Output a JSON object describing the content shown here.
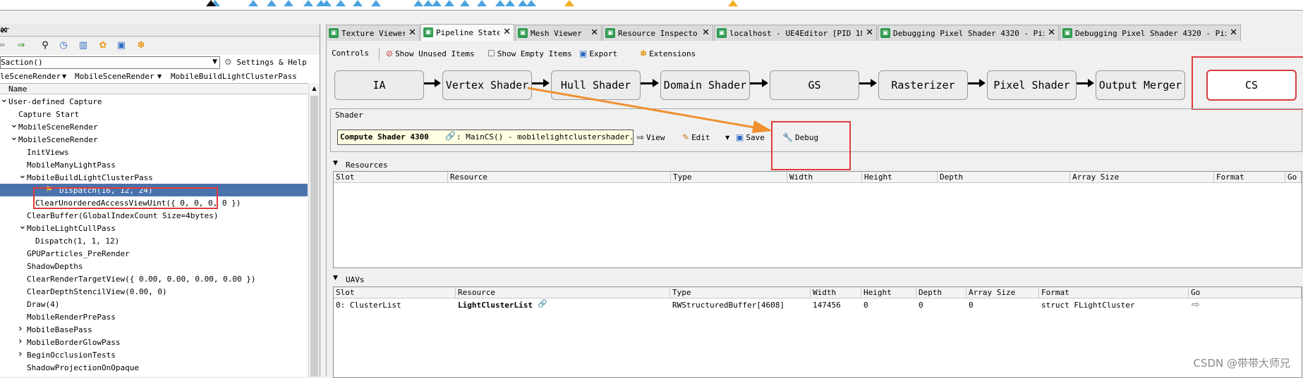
{
  "left_panel": {
    "title": "er",
    "section": "Saction()",
    "settings_help": "Settings & Help",
    "breadcrumb": [
      "leSceneRender",
      "MobileSceneRender",
      "MobileBuildLightClusterPass"
    ],
    "column_header": "Name",
    "tree": [
      {
        "label": "User-defined Capture",
        "indent": 0,
        "expander": "open"
      },
      {
        "label": "Capture Start",
        "indent": 1,
        "expander": "none"
      },
      {
        "label": "MobileSceneRender",
        "indent": 1,
        "expander": "open"
      },
      {
        "label": "MobileSceneRender",
        "indent": 2,
        "expander": "open"
      },
      {
        "label": "InitViews",
        "indent": 3,
        "expander": "none"
      },
      {
        "label": "MobileManyLightPass",
        "indent": 3,
        "expander": "none"
      },
      {
        "label": "MobileBuildLightClusterPass",
        "indent": 3,
        "expander": "open"
      },
      {
        "label": "Dispatch(16, 12, 24)",
        "indent": 4,
        "expander": "flag",
        "selected": true
      },
      {
        "label": "ClearUnorderedAccessViewUint({ 0, 0, 0, 0 })",
        "indent": 4,
        "expander": "none"
      },
      {
        "label": "ClearBuffer(GlobalIndexCount Size=4bytes)",
        "indent": 3,
        "expander": "none"
      },
      {
        "label": "MobileLightCullPass",
        "indent": 3,
        "expander": "open"
      },
      {
        "label": "Dispatch(1, 1, 12)",
        "indent": 4,
        "expander": "none"
      },
      {
        "label": "GPUParticles_PreRender",
        "indent": 3,
        "expander": "none"
      },
      {
        "label": "ShadowDepths",
        "indent": 3,
        "expander": "none"
      },
      {
        "label": "ClearRenderTargetView({ 0.00, 0.00, 0.00, 0.00 })",
        "indent": 3,
        "expander": "none"
      },
      {
        "label": "ClearDepthStencilView(0.00, 0)",
        "indent": 3,
        "expander": "none"
      },
      {
        "label": "Draw(4)",
        "indent": 3,
        "expander": "none"
      },
      {
        "label": "MobileRenderPrePass",
        "indent": 3,
        "expander": "none"
      },
      {
        "label": "MobileBasePass",
        "indent": 3,
        "expander": "closed"
      },
      {
        "label": "MobileBorderGlowPass",
        "indent": 3,
        "expander": "closed"
      },
      {
        "label": "BeginOcclusionTests",
        "indent": 3,
        "expander": "closed"
      },
      {
        "label": "ShadowProjectionOnOpaque",
        "indent": 3,
        "expander": "none"
      }
    ]
  },
  "tabs": [
    {
      "label": "Texture Viewer",
      "active": false
    },
    {
      "label": "Pipeline State",
      "active": true
    },
    {
      "label": "Mesh Viewer",
      "active": false
    },
    {
      "label": "Resource Inspector",
      "active": false
    },
    {
      "label": "localhost - UE4Editor [PID 18240]",
      "active": false
    },
    {
      "label": "Debugging Pixel Shader 4320 - Pix…",
      "active": false
    },
    {
      "label": "Debugging Pixel Shader 4320 - Pix…",
      "active": false
    }
  ],
  "controls": {
    "label": "Controls",
    "show_unused": "Show Unused Items",
    "show_empty": "Show Empty Items",
    "export": "Export",
    "extensions": "Extensions"
  },
  "pipeline": {
    "stages": [
      "IA",
      "Vertex Shader",
      "Hull Shader",
      "Domain Shader",
      "GS",
      "Rasterizer",
      "Pixel Shader",
      "Output Merger",
      "CS"
    ],
    "active": "CS"
  },
  "shader": {
    "group_title": "Shader",
    "name": "Compute Shader 4300",
    "entry": ":  MainCS()  -  mobilelightclustershader.usf",
    "view": "View",
    "edit": "Edit",
    "save": "Save",
    "debug": "Debug"
  },
  "resources": {
    "title": "Resources",
    "columns": [
      "Slot",
      "Resource",
      "Type",
      "Width",
      "Height",
      "Depth",
      "Array Size",
      "Format",
      "Go"
    ]
  },
  "uavs": {
    "title": "UAVs",
    "columns": [
      "Slot",
      "Resource",
      "Type",
      "Width",
      "Height",
      "Depth",
      "Array Size",
      "Format",
      "Go"
    ],
    "rows": [
      [
        "0: ClusterList",
        "LightClusterList",
        "RWStructuredBuffer[4608]",
        "147456",
        "0",
        "0",
        "0",
        "struct FLightCluster",
        ""
      ]
    ]
  },
  "watermark": "CSDN @带带大师兄",
  "colors": {
    "selection": "#4a73ad",
    "highlight_red": "#e03b3b",
    "annotation_arrow": "#f0902f",
    "tab_icon": "#2e9b4f"
  }
}
